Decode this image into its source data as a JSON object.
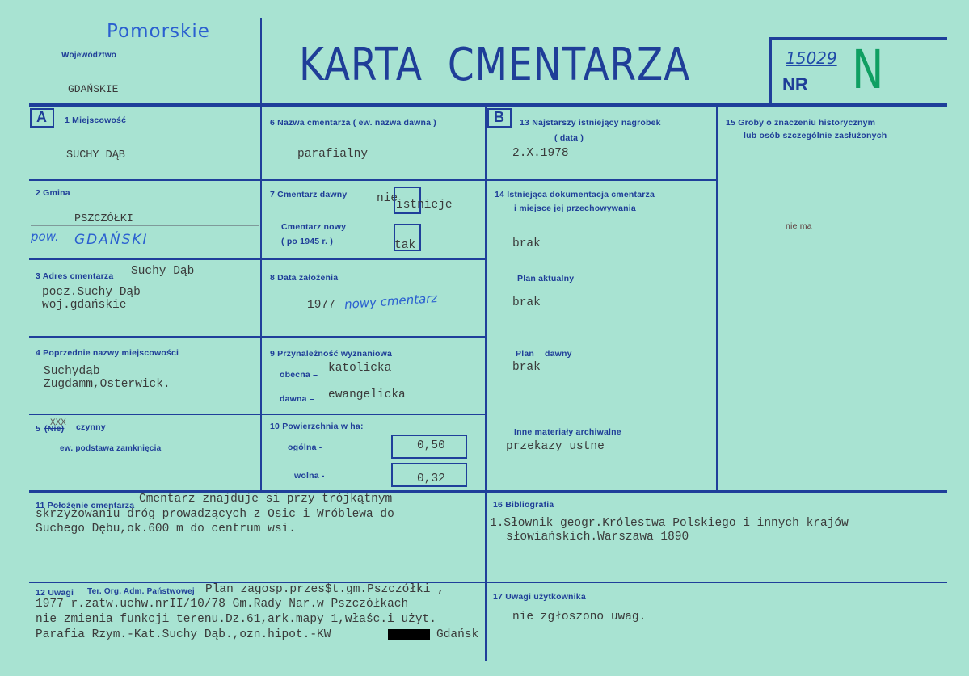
{
  "header": {
    "region_handwritten": "Pomorskie",
    "voivodeship_label": "Województwo",
    "voivodeship_value": "GDAŃSKIE",
    "title": "KARTA CMENTARZA",
    "number_handwritten": "15029",
    "nr_label": "NR",
    "nr_letter": "N"
  },
  "section_letters": {
    "a": "A",
    "b": "B"
  },
  "fields": {
    "f1": {
      "label": "1 Miejscowość",
      "value": "SUCHY DĄB"
    },
    "f2": {
      "label": "2 Gmina",
      "value": "PSZCZÓŁKI",
      "pow_handwritten": "pow.",
      "county_handwritten": "GDAŃSKI"
    },
    "f3": {
      "label": "3 Adres cmentarza",
      "line0": "Suchy Dąb",
      "line1": "pocz.Suchy Dąb",
      "line2": "woj.gdańskie"
    },
    "f4": {
      "label": "4 Poprzednie nazwy miejscowości",
      "line1": "Suchydąb",
      "line2": "Zugdamm,Osterwick."
    },
    "f5": {
      "label_num": "5",
      "label_nie": "(Nie)",
      "label_czynny": "czynny",
      "strike": "XXX",
      "label2": "ew. podstawa zamknięcia"
    },
    "f6": {
      "label": "6 Nazwa cmentarza ( ew. nazwa dawna )",
      "value": "parafialny"
    },
    "f7": {
      "label": "7 Cmentarz dawny",
      "nie": "nie",
      "istnieje": "istnieje",
      "label2a": "Cmentarz nowy",
      "label2b": "( po 1945 r. )",
      "tak": "tak"
    },
    "f8": {
      "label": "8 Data założenia",
      "value": "1977",
      "handwritten": "nowy cmentarz"
    },
    "f9": {
      "label": "9 Przynależność wyznaniowa",
      "obecna_label": "obecna –",
      "obecna_value": "katolicka",
      "dawna_label": "dawna –",
      "dawna_value": "ewangelicka"
    },
    "f10": {
      "label": "10 Powierzchnia w ha:",
      "ogolna_label": "ogólna -",
      "ogolna_value": "0,50",
      "wolna_label": "wolna -",
      "wolna_value": "0,32"
    },
    "f11": {
      "label": "11 Położenie cmentarza",
      "line1": "Cmentarz znajduje si przy trójkątnym",
      "line2": "skrzyżowaniu dróg prowadzących z Osic i Wróblewa do",
      "line3": "Suchego Dębu,ok.600 m do centrum wsi."
    },
    "f12": {
      "label": "12 Uwagi",
      "label2": "Ter. Org. Adm. Państwowej",
      "line1": "Plan zagosp.przes$t.gm.Pszczółki ,",
      "line2": "1977 r.zatw.uchw.nrII/10/78 Gm.Rady Nar.w Pszczółkach",
      "line3": "nie zmienia funkcji terenu.Dz.61,ark.mapy 1,właśc.i użyt.",
      "line4a": "Parafia Rzym.-Kat.Suchy Dąb.,ozn.hipot.-KW",
      "line4b": "Gdańsk"
    },
    "f13": {
      "label": "13 Najstarszy istniejący nagrobek",
      "label2": "( data )",
      "value": "2.X.1978"
    },
    "f14": {
      "label": "14 Istniejąca dokumentacja cmentarza",
      "label2": "i miejsce jej przechowywania",
      "value": "brak",
      "plan_akt_label": "Plan aktualny",
      "plan_akt_value": "brak",
      "plan_dawny_label1": "Plan",
      "plan_dawny_label2": "dawny",
      "plan_dawny_value": "brak",
      "inne_label": "Inne materiały archiwalne",
      "inne_value": "przekazy ustne"
    },
    "f15": {
      "label": "15 Groby o znaczeniu historycznym",
      "label2": "lub osób szczególnie zasłużonych",
      "value": "nie ma"
    },
    "f16": {
      "label": "16 Bibliografia",
      "line1": "1.Słownik geogr.Królestwa Polskiego i innych krajów",
      "line2": "słowiańskich.Warszawa 1890"
    },
    "f17": {
      "label": "17 Uwagi użytkownika",
      "value": "nie zgłoszono uwag."
    }
  }
}
